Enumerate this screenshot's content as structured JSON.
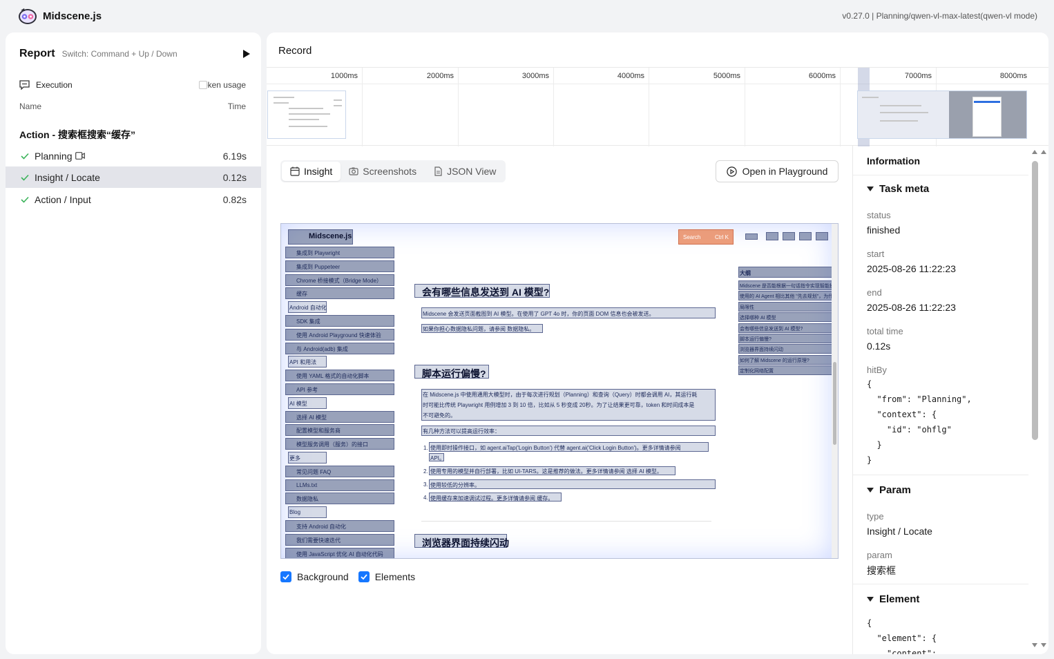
{
  "app": {
    "name": "Midscene.js",
    "version": "v0.27.0 | Planning/qwen-vl-max-latest(qwen-vl mode)"
  },
  "report": {
    "title": "Report",
    "hint": "Switch: Command + Up / Down",
    "execution_label": "Execution",
    "token_usage_label": "Token usage",
    "col_name": "Name",
    "col_time": "Time",
    "group_title": "Action - 搜索框搜索“缓存”",
    "tasks": [
      {
        "name": "Planning",
        "time": "6.19s"
      },
      {
        "name": "Insight / Locate",
        "time": "0.12s"
      },
      {
        "name": "Action / Input",
        "time": "0.82s"
      }
    ]
  },
  "record": {
    "title": "Record",
    "ticks": [
      "1000ms",
      "2000ms",
      "3000ms",
      "4000ms",
      "5000ms",
      "6000ms",
      "7000ms",
      "8000ms"
    ]
  },
  "insight": {
    "tabs": [
      "Insight",
      "Screenshots",
      "JSON View"
    ],
    "open_playground": "Open in Playground",
    "toggle_background": "Background",
    "toggle_elements": "Elements",
    "screenshot": {
      "site_name": "Midscene.js",
      "search_placeholder": "Search",
      "search_shortcut": "Ctrl K",
      "h1": "会有哪些信息发送到 AI 模型?",
      "p1": "Midscene 会发送页面截图到 AI 模型。在使用了 GPT 4o 时，你的页面 DOM 信息也会被发送。",
      "p2": "如果你担心数据隐私问题，请参阅 数据隐私。",
      "h2": "脚本运行偏慢?",
      "p3a": "在 Midscene.js 中使用通用大模型时，由于每次进行规划（Planning）和查询（Query）时都会调用 AI，其运行耗",
      "p3b": "时可能比传统 Playwright 用例增加 3 到 10 倍，比如从 5 秒变成 20秒。为了让结果更可靠，token 和时间成本是",
      "p3c": "不可避免的。",
      "p4": "有几种方法可以提高运行效率：",
      "li1": "使用即时操作接口，如 agent.aiTap('Login Button') 代替 agent.ai('Click Login Button')。更多详情请参阅",
      "li1b": "API。",
      "li2": "使用专用的模型并自行部署，比如 UI-TARS。这是推荐的做法。更多详情请参阅 选择 AI 模型。",
      "li3": "使用较低的分辨率。",
      "li4": "使用缓存来加速调试过程。更多详情请参阅 缓存。",
      "h3": "浏览器界面持续闪动",
      "outline_title": "大纲",
      "sidebar_items": [
        "集成到 Playwright",
        "集成到 Puppeteer",
        "Chrome 桥接模式（Bridge Mode）",
        "缓存",
        "Android 自动化",
        "SDK 集成",
        "使用 Android Playground 快速体验",
        "与 Android(adb) 集成",
        "API 和用法",
        "使用 YAML 格式的自动化脚本",
        "API 参考",
        "AI 模型",
        "选择 AI 模型",
        "配置模型和服务商",
        "模型服务调用（服务）的接口",
        "更多",
        "常见问题 FAQ",
        "LLMs.txt",
        "数据隐私",
        "Blog",
        "支持 Android 自动化",
        "我们需要快速迭代",
        "使用 JavaScript 优化 AI 自动化代码"
      ],
      "outline_items": [
        "Midscene 是否能根据一句话指令实现智能操作？",
        "使用的 AI Agent 相比其他 \"先去规划\"，为什么 Midscene 还是推荐使用明确的指令？",
        "局限性",
        "选择哪种 AI 模型",
        "会有哪些信息发送到 AI 模型?",
        "脚本运行偏慢?",
        "浏览器界面持续闪动",
        "如何了解 Midscene 的运行原理?",
        "定制化网络配置"
      ]
    }
  },
  "information": {
    "title": "Information",
    "task_meta": {
      "title": "Task meta",
      "status_k": "status",
      "status_v": "finished",
      "start_k": "start",
      "start_v": "2025-08-26 11:22:23",
      "end_k": "end",
      "end_v": "2025-08-26 11:22:23",
      "total_k": "total time",
      "total_v": "0.12s",
      "hitby_k": "hitBy",
      "hitby_code": "{\n  \"from\": \"Planning\",\n  \"context\": {\n    \"id\": \"ohflg\"\n  }\n}"
    },
    "param": {
      "title": "Param",
      "type_k": "type",
      "type_v": "Insight / Locate",
      "param_k": "param",
      "param_v": "搜索框"
    },
    "element": {
      "title": "Element",
      "code": "{\n  \"element\": {\n    \"content\":"
    }
  },
  "colors": {
    "accent": "#1677ff",
    "active_row": "#e3e4ea",
    "highlight": "#e98c64"
  }
}
